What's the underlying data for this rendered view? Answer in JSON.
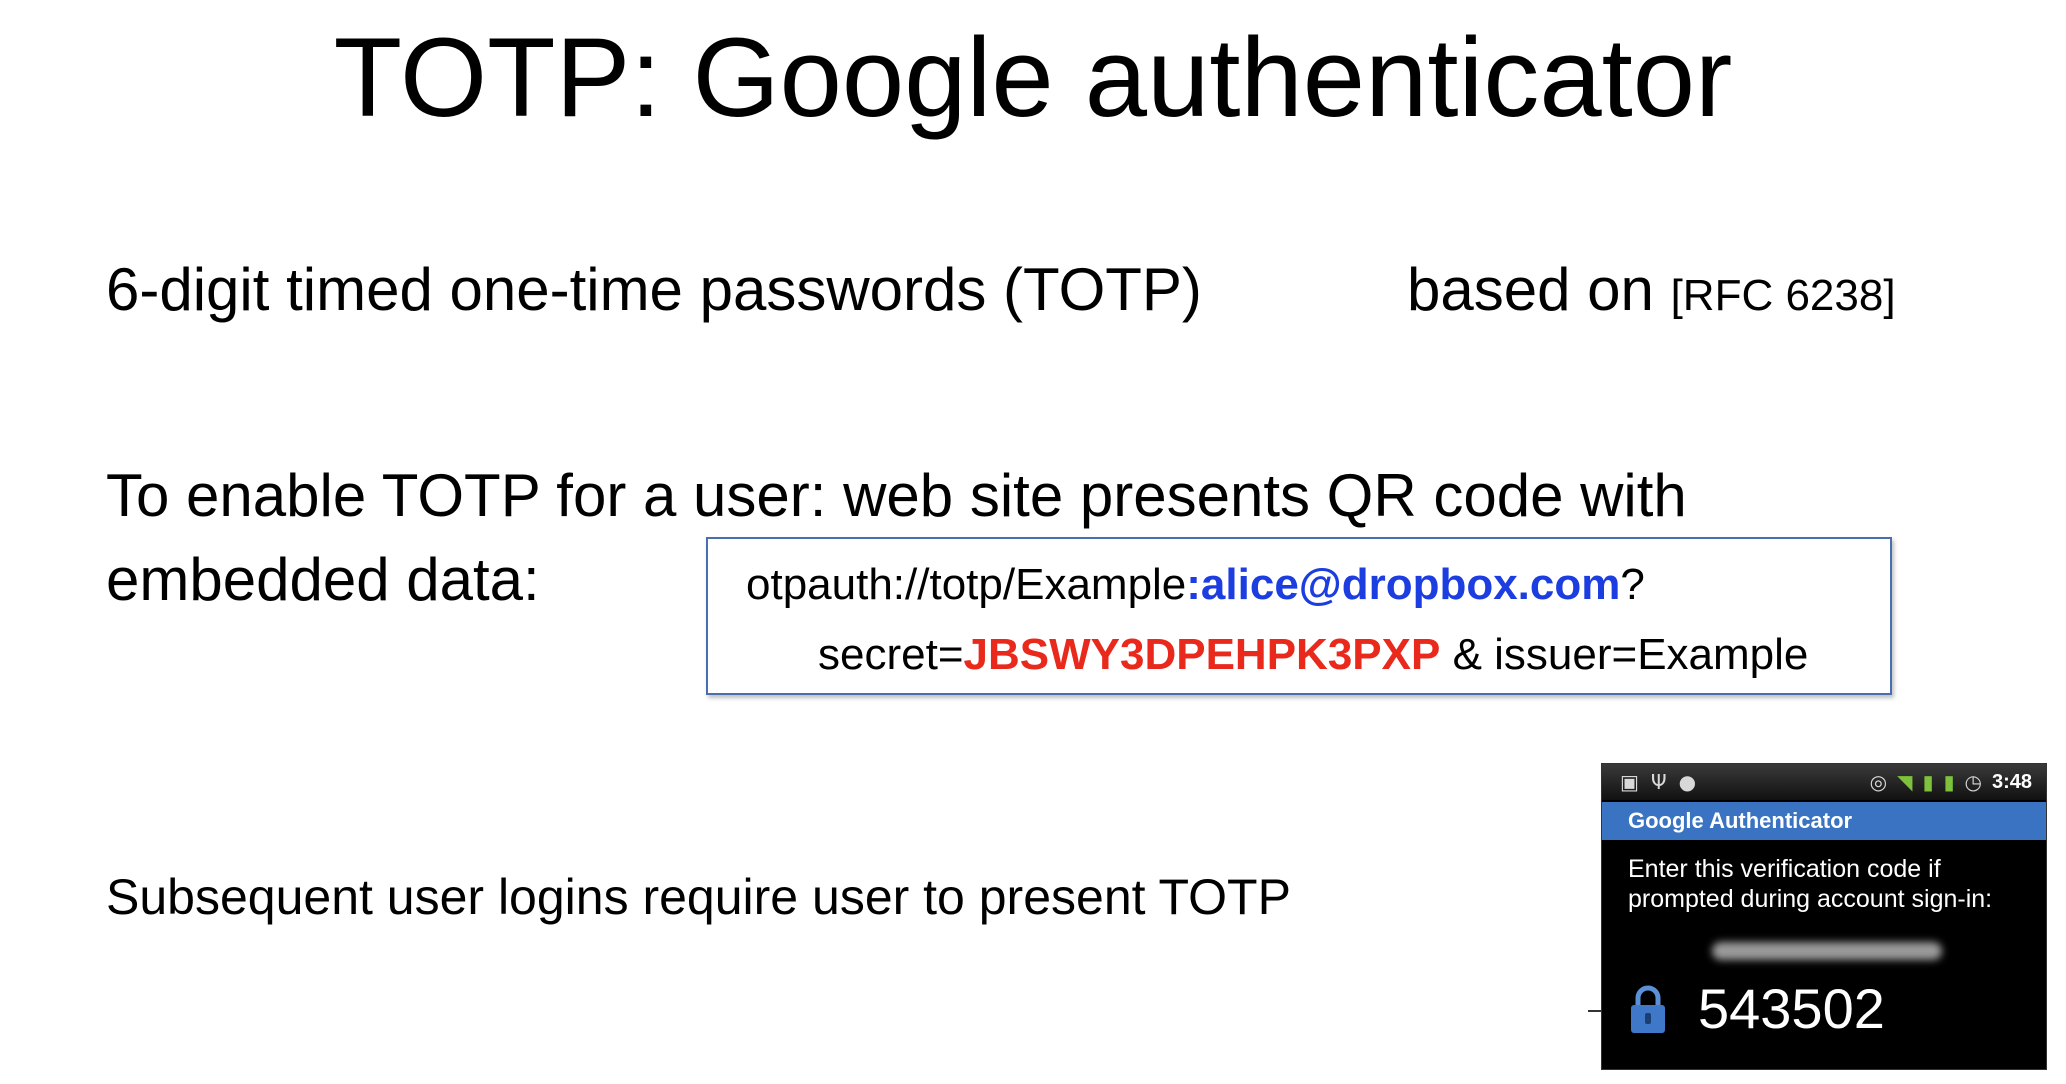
{
  "title": "TOTP:  Google authenticator",
  "bullets": {
    "totp_desc": "6-digit timed one-time passwords (TOTP)",
    "based_on": "based on ",
    "rfc": "[RFC 6238]",
    "enable_line1": "To enable TOTP for a user:   web site presents QR code with",
    "enable_line2": "embedded data:",
    "subsequent": "Subsequent user logins require user to present TOTP"
  },
  "uri_box": {
    "line1_prefix": "otpauth://totp/Example",
    "account": ":alice@dropbox.com",
    "line1_suffix": "?",
    "line2_prefix": "secret=",
    "secret": "JBSWY3DPEHPK3PXP",
    "line2_suffix": " & issuer=Example"
  },
  "phone": {
    "status_time": "3:48",
    "app_title": "Google Authenticator",
    "prompt_line1": "Enter this verification code if",
    "prompt_line2": "prompted during account sign-in:",
    "code": "543502",
    "status_icons": [
      "briefcase-icon",
      "usb-icon",
      "android-icon",
      "sync-icon",
      "wifi-icon",
      "signal-icon",
      "battery-icon",
      "alarm-icon"
    ]
  },
  "colors": {
    "account": "#1c3de0",
    "secret": "#e8291c",
    "app_bar": "#3a73c2",
    "box_border": "#4a6fb0"
  }
}
